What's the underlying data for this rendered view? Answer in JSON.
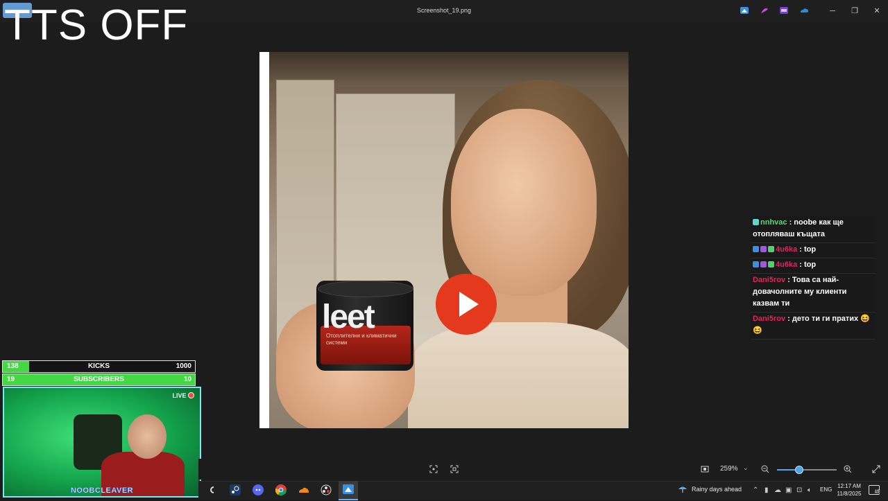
{
  "window": {
    "title": "Screenshot_19.png",
    "controls": {
      "minimize": "─",
      "maximize": "❐",
      "close": "✕"
    }
  },
  "overlay": {
    "tts_text": "TTS OFF"
  },
  "image": {
    "jar_brand": "leet",
    "jar_subtitle": "Отоплителни и климатични системи"
  },
  "chat": {
    "messages": [
      {
        "user": "nnhvac",
        "user_color": "#5ed67a",
        "text": " : noobe как ще отопляваш къщата",
        "badges": [
          "sword"
        ]
      },
      {
        "user": "4u6ka",
        "user_color": "#e0245e",
        "text": " : top",
        "badges": [
          "blue",
          "purple",
          "green"
        ]
      },
      {
        "user": "4u6ka",
        "user_color": "#e0245e",
        "text": " : top",
        "badges": [
          "blue",
          "purple",
          "green"
        ]
      },
      {
        "user": "Dani5rov",
        "user_color": "#e0245e",
        "text": " : Това са най-довачолните му клиенти казвам ти",
        "badges": []
      },
      {
        "user": "Dani5rov",
        "user_color": "#e0245e",
        "text": " : дето ти ги пратих 😆 😆",
        "badges": []
      }
    ]
  },
  "stream_overlay": {
    "kicks": {
      "current": "138",
      "label": "KICKS",
      "goal": "1000",
      "progress": 0.138
    },
    "subscribers": {
      "current": "19",
      "label": "SUBSCRIBERS",
      "goal": "10",
      "progress": 1.0
    },
    "live_label": "LIVE",
    "streamer_name": "NOOBCLEAVER",
    "accent_color": "#43d844"
  },
  "viewer_toolbar": {
    "zoom_label": "259%",
    "zoom_progress": 0.36
  },
  "taskbar": {
    "weather": "Rainy days ahead",
    "language": "ENG",
    "time": "12:17 AM",
    "date": "11/8/2025",
    "notification_count": "15"
  }
}
